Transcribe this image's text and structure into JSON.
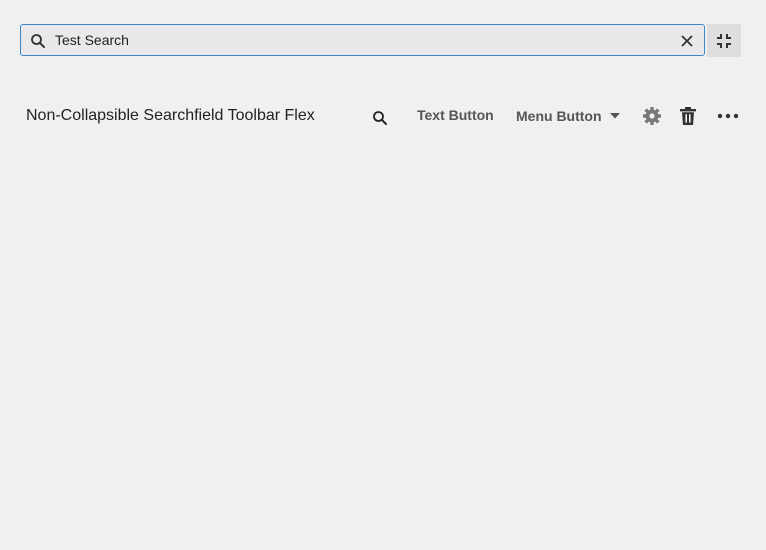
{
  "search": {
    "value": "Test Search",
    "icon": "search-icon",
    "clear_icon": "close-icon",
    "collapse_icon": "fullscreen-exit-icon",
    "focus_color": "#3b86c7"
  },
  "toolbar": {
    "title": "Non-Collapsible Searchfield Toolbar Flex",
    "text_button_label": "Text Button",
    "menu_button_label": "Menu Button",
    "icons": [
      "search-icon",
      "gear-icon",
      "trash-icon",
      "more-horizontal-icon"
    ]
  }
}
